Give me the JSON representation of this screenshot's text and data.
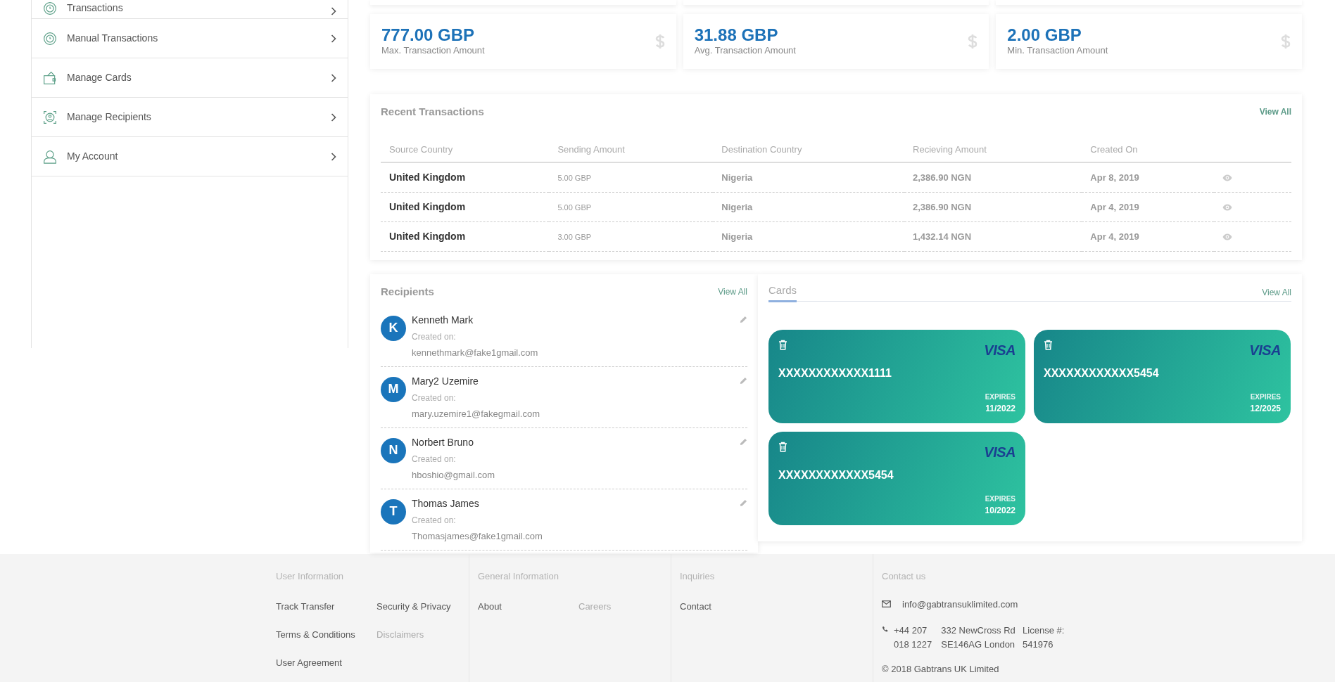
{
  "sidebar": {
    "items": [
      {
        "label": "Transactions"
      },
      {
        "label": "Manual Transactions"
      },
      {
        "label": "Manage Cards"
      },
      {
        "label": "Manage Recipients"
      },
      {
        "label": "My Account"
      }
    ]
  },
  "stats": [
    {
      "value": "777.00 GBP",
      "label": "Max. Transaction Amount"
    },
    {
      "value": "31.88 GBP",
      "label": "Avg. Transaction Amount"
    },
    {
      "value": "2.00 GBP",
      "label": "Min. Transaction Amount"
    }
  ],
  "recent_transactions": {
    "title": "Recent Transactions",
    "view_all": "View All",
    "columns": [
      "Source Country",
      "Sending Amount",
      "Destination Country",
      "Recieving Amount",
      "Created On"
    ],
    "rows": [
      {
        "source_country": "United Kingdom",
        "sending_amount": "5.00 GBP",
        "destination_country": "Nigeria",
        "receiving_amount": "2,386.90 NGN",
        "created_on": "Apr 8, 2019"
      },
      {
        "source_country": "United Kingdom",
        "sending_amount": "5.00 GBP",
        "destination_country": "Nigeria",
        "receiving_amount": "2,386.90 NGN",
        "created_on": "Apr 4, 2019"
      },
      {
        "source_country": "United Kingdom",
        "sending_amount": "3.00 GBP",
        "destination_country": "Nigeria",
        "receiving_amount": "1,432.14 NGN",
        "created_on": "Apr 4, 2019"
      }
    ]
  },
  "recipients": {
    "title": "Recipients",
    "view_all": "View All",
    "items": [
      {
        "initial": "K",
        "name": "Kenneth Mark",
        "created_label": "Created on:",
        "email": "kennethmark@fake1gmail.com"
      },
      {
        "initial": "M",
        "name": "Mary2 Uzemire",
        "created_label": "Created on:",
        "email": "mary.uzemire1@fakegmail.com"
      },
      {
        "initial": "N",
        "name": "Norbert Bruno",
        "created_label": "Created on:",
        "email": "hboshio@gmail.com"
      },
      {
        "initial": "T",
        "name": "Thomas James",
        "created_label": "Created on:",
        "email": "Thomasjames@fake1gmail.com"
      }
    ]
  },
  "cards": {
    "tabs": [
      {
        "label": "Cards",
        "selected": true
      }
    ],
    "view_all": "View All",
    "items": [
      {
        "brand": "VISA",
        "number": "XXXXXXXXXXXX1111",
        "expires_label": "EXPIRES",
        "expiry": "11/2022"
      },
      {
        "brand": "VISA",
        "number": "XXXXXXXXXXXX5454",
        "expires_label": "EXPIRES",
        "expiry": "12/2025"
      },
      {
        "brand": "VISA",
        "number": "XXXXXXXXXXXX5454",
        "expires_label": "EXPIRES",
        "expiry": "10/2022"
      }
    ]
  },
  "footer": {
    "columns": [
      {
        "heading": "User Information",
        "links": [
          {
            "label": "Track Transfer",
            "muted": false
          },
          {
            "label": "Security & Privacy",
            "muted": false
          },
          {
            "label": "Terms & Conditions",
            "muted": false
          },
          {
            "label": "Disclaimers",
            "muted": true
          },
          {
            "label": "User Agreement",
            "muted": false
          }
        ]
      },
      {
        "heading": "General Information",
        "links": [
          {
            "label": "About",
            "muted": false
          },
          {
            "label": "Careers",
            "muted": true
          }
        ]
      },
      {
        "heading": "Inquiries",
        "links": [
          {
            "label": "Contact",
            "muted": false
          }
        ]
      }
    ],
    "contact": {
      "heading": "Contact us",
      "email": "info@gabtransuklimited.com",
      "phone": "+44 207 018 1227",
      "address": "332 NewCross Rd SE146AG London",
      "license": "License #: 541976",
      "copyright": "© 2018 Gabtrans UK Limited"
    }
  }
}
